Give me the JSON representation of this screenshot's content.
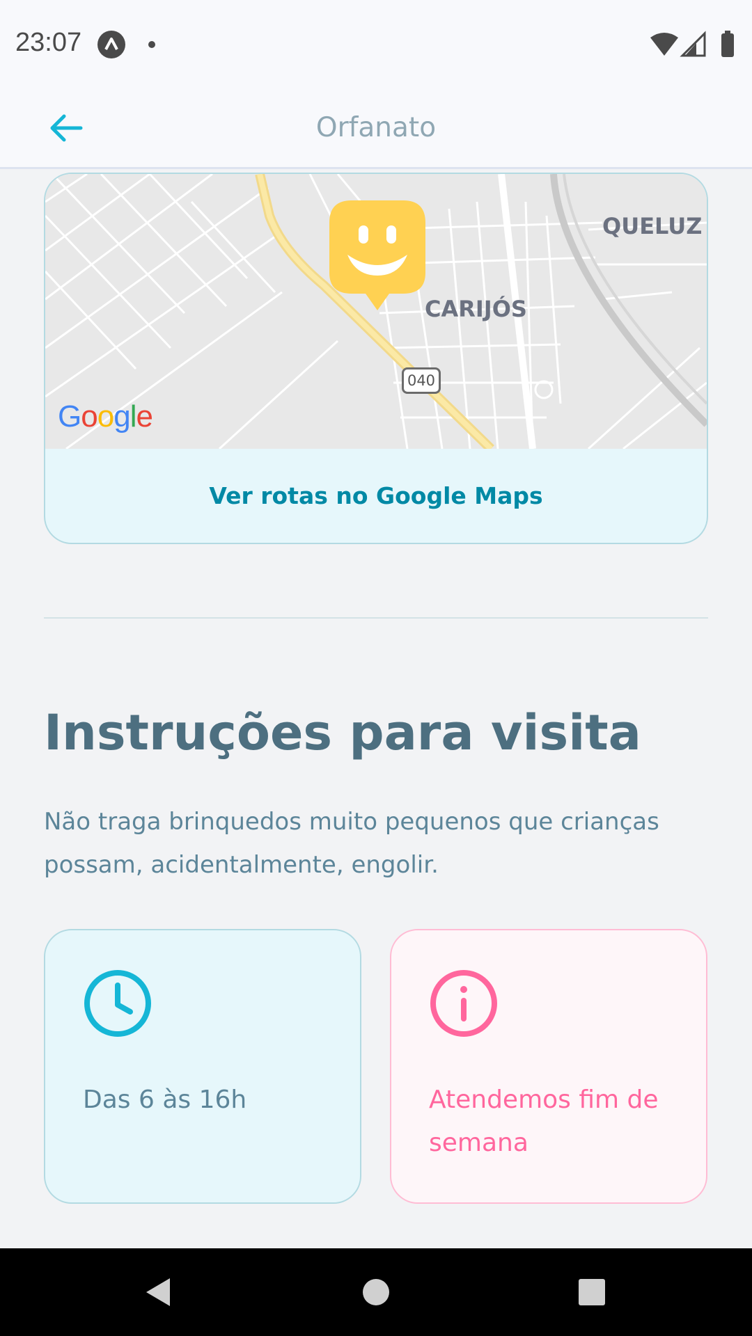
{
  "status_bar": {
    "time": "23:07"
  },
  "header": {
    "title": "Orfanato",
    "back_icon": "arrow-left-icon"
  },
  "map": {
    "labels": {
      "queluz": "QUELUZ",
      "carijos": "CARIJÓS",
      "road_number": "040"
    },
    "logo": "Google",
    "routes_button": "Ver rotas no Google Maps"
  },
  "instructions": {
    "title": "Instruções para visita",
    "text": "Não traga brinquedos muito pequenos que crianças possam, acidentalmente, engolir."
  },
  "cards": {
    "hours": {
      "icon": "clock-icon",
      "text": "Das 6 às 16h"
    },
    "weekend": {
      "icon": "info-icon",
      "text": "Atendemos fim de semana"
    }
  },
  "colors": {
    "primary": "#15b6d6",
    "title": "#4d6f80",
    "body_text": "#5c8599",
    "pink": "#ff669d",
    "marker": "#ffd152",
    "background": "#f2f3f5"
  }
}
